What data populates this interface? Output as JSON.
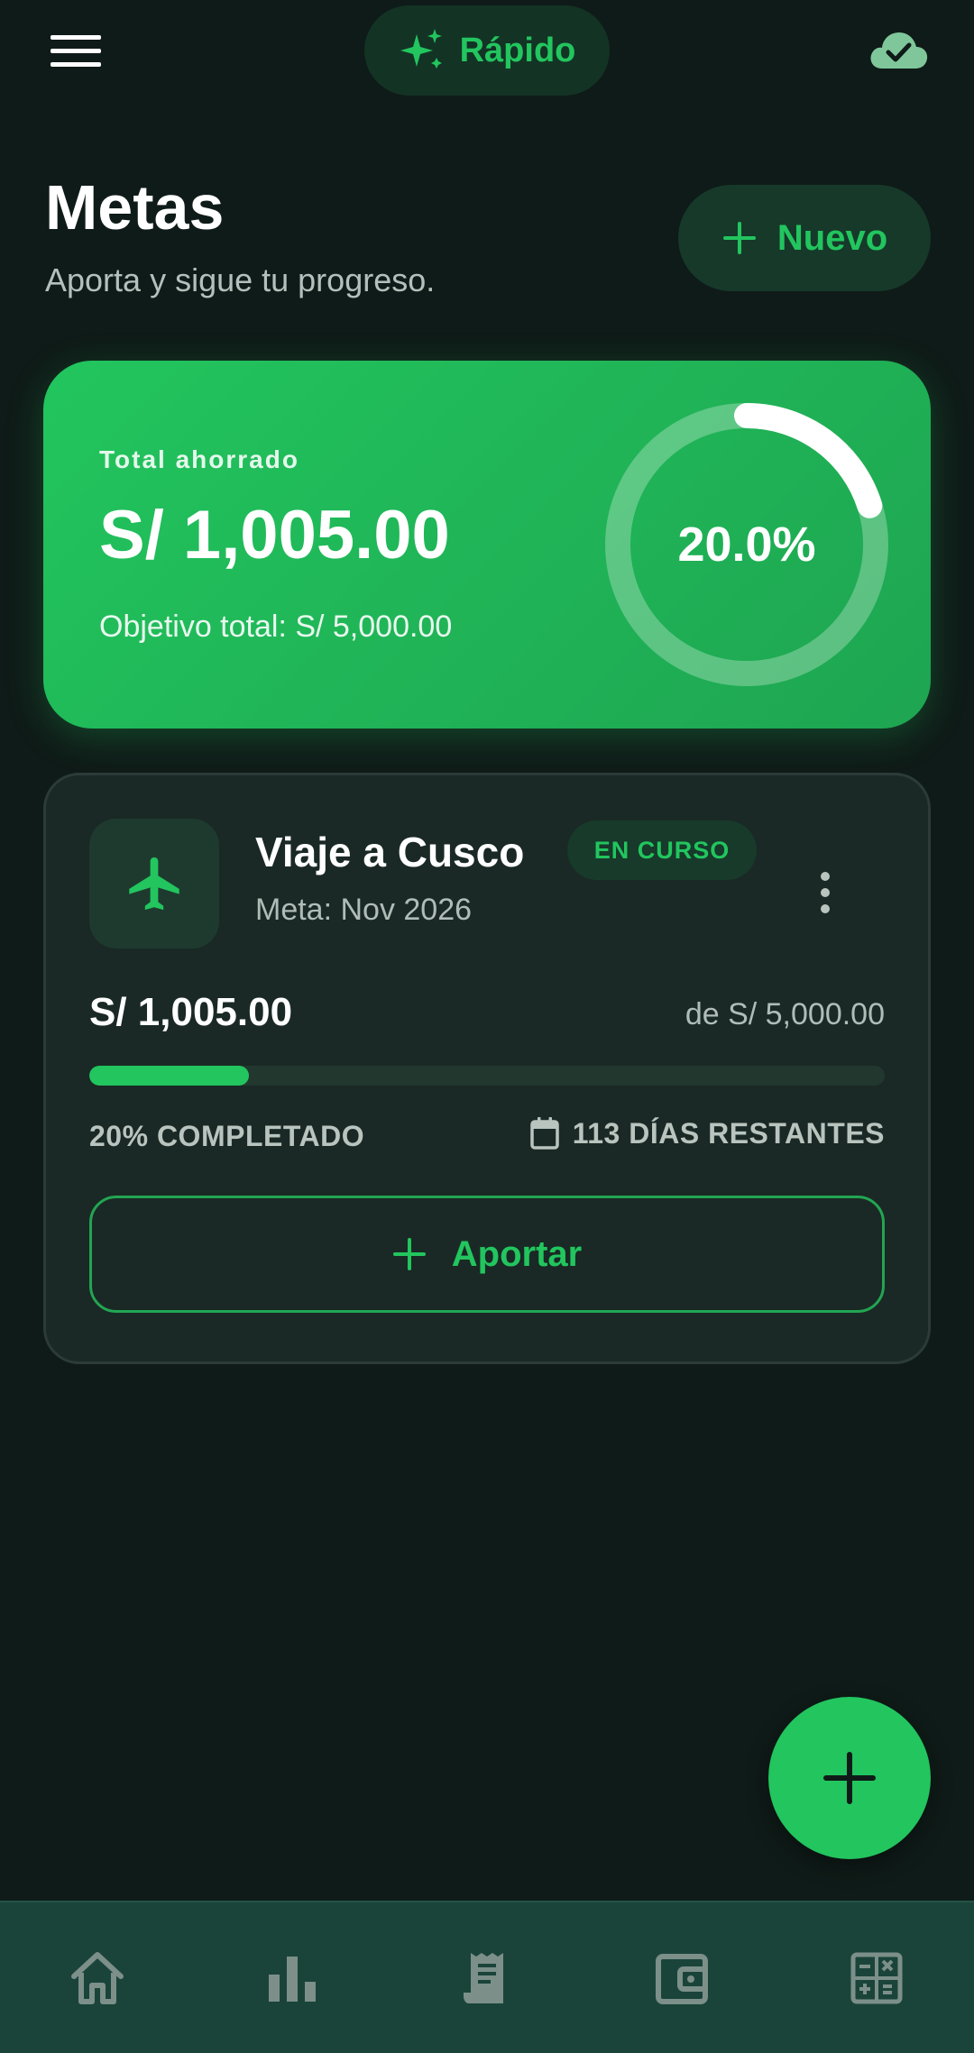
{
  "topbar": {
    "quick_label": "Rápido",
    "icons": {
      "menu": "menu-icon",
      "quick": "sparkles-icon",
      "sync": "cloud-check-icon"
    }
  },
  "header": {
    "title": "Metas",
    "subtitle": "Aporta y sigue tu progreso.",
    "new_label": "Nuevo"
  },
  "summary": {
    "label": "Total ahorrado",
    "amount": "S/ 1,005.00",
    "target": "Objetivo total: S/ 5,000.00",
    "percent_text": "20.0%",
    "percent_value": 0.201
  },
  "goals": [
    {
      "name": "Viaje a Cusco",
      "date": "Meta: Nov 2026",
      "status": "EN CURSO",
      "saved": "S/ 1,005.00",
      "of_total": "de S/ 5,000.00",
      "progress": 0.201,
      "percent_label": "20% COMPLETADO",
      "remaining_label": "113 DÍAS RESTANTES",
      "contribute_label": "Aportar",
      "icon": "airplane-icon"
    }
  ],
  "nav": {
    "items": [
      "home-icon",
      "bar-chart-icon",
      "receipt-icon",
      "wallet-icon",
      "calculator-icon"
    ]
  },
  "colors": {
    "background": "#0f1b18",
    "accent": "#22c55e",
    "card": "#1a2925",
    "nav": "#1a443a",
    "muted_text": "#b0bcb7"
  }
}
